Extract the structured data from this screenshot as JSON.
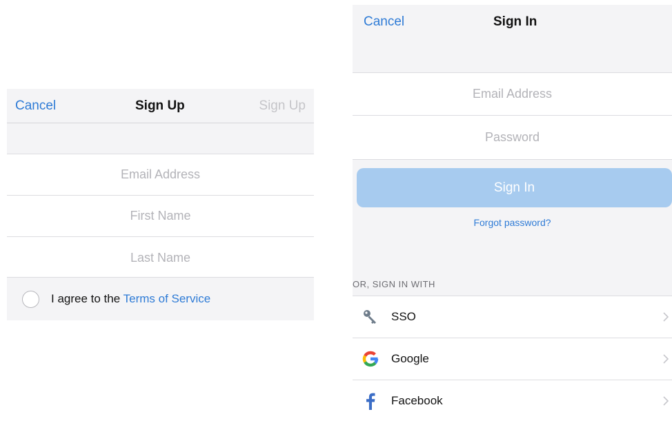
{
  "signup": {
    "cancel_label": "Cancel",
    "title": "Sign Up",
    "submit_label": "Sign Up",
    "fields": [
      {
        "placeholder": "Email Address"
      },
      {
        "placeholder": "First Name"
      },
      {
        "placeholder": "Last Name"
      }
    ],
    "agree_text": "I agree to the ",
    "terms_link": "Terms of Service"
  },
  "signin": {
    "cancel_label": "Cancel",
    "title": "Sign In",
    "fields": [
      {
        "placeholder": "Email Address"
      },
      {
        "placeholder": "Password"
      }
    ],
    "button_label": "Sign In",
    "forgot_label": "Forgot password?",
    "or_label": "OR, SIGN IN WITH",
    "providers": [
      {
        "label": "SSO",
        "icon": "key-icon"
      },
      {
        "label": "Google",
        "icon": "google-icon"
      },
      {
        "label": "Facebook",
        "icon": "facebook-icon"
      }
    ]
  },
  "colors": {
    "accent": "#2e7bd6",
    "button_disabled": "#a7cbef",
    "panel_bg": "#f4f4f6",
    "placeholder": "#b3b3b8"
  }
}
